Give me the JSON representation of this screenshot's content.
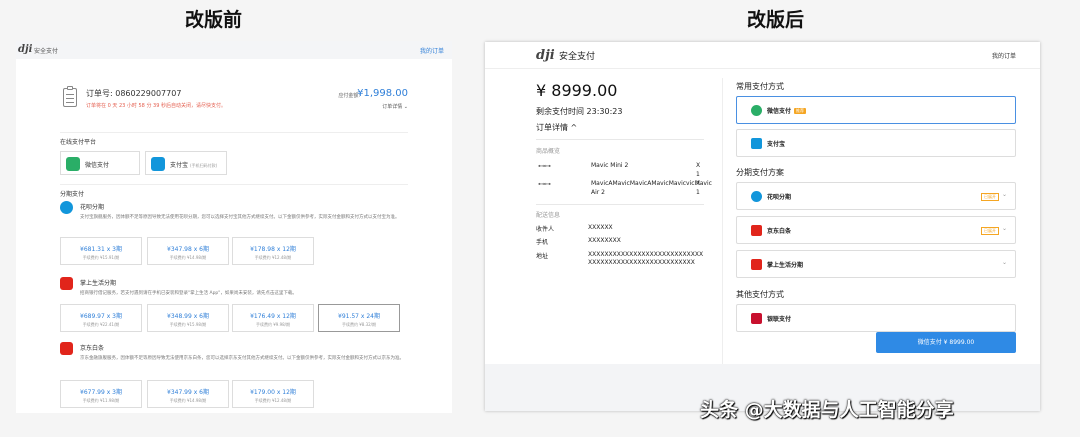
{
  "headings": {
    "before": "改版前",
    "after": "改版后"
  },
  "colors": {
    "accent": "#2f7fd8",
    "wechat_green": "#2aae67",
    "alipay_blue": "#1296db",
    "warn_red": "#e45d4d",
    "badge_orange": "#f5a623",
    "jd_red": "#e1251b"
  },
  "before": {
    "logo": "dji",
    "title": "安全支付",
    "my_orders": "我的订单",
    "order": {
      "number_label": "订单号: 0860229007707",
      "deadline": "订单将在 0 天 23 小时 58 分 39 秒后自动关闭，请尽快支付。",
      "amount_label": "应付金额:",
      "amount": "¥1,998.00",
      "details": "订单详情 ⌄"
    },
    "online_platform": "在线支付平台",
    "wechat": "微信支付",
    "alipay": "支付宝",
    "alipay_note": "(手机扫码付款)",
    "installments_title": "分期支付",
    "huabei": {
      "name": "花呗分期",
      "desc": "支付宝旗舰服务，因体额不足等原因导致无法使用花呗分期，您可以选择支付宝其他方式继续支付。以下金额仅供参考，实际支付金额和支付方式以支付宝为准。",
      "options": [
        {
          "value": "¥681.31 x 3期",
          "fee": "手续费约 ¥15.91/期"
        },
        {
          "value": "¥347.98 x 6期",
          "fee": "手续费约 ¥14.98/期"
        },
        {
          "value": "¥178.98 x 12期",
          "fee": "手续费约 ¥12.48/期"
        }
      ]
    },
    "zsh": {
      "name": "掌上生活分期",
      "desc": "招商银行借记服务，若支付遇到请在手机已安装和登录\"掌上生活 App\"，如果尚未安装，请先点击这里下载。",
      "options": [
        {
          "value": "¥689.97 x 3期",
          "fee": "手续费约 ¥22.41/期"
        },
        {
          "value": "¥348.99 x 6期",
          "fee": "手续费约 ¥15.98/期"
        },
        {
          "value": "¥176.49 x 12期",
          "fee": "手续费约 ¥9.98/期"
        },
        {
          "value": "¥91.57 x 24期",
          "fee": "手续费约 ¥8.32/期"
        }
      ]
    },
    "jd": {
      "name": "京东白条",
      "desc": "京东金融旗舰服务，因体额不足等原因导致无法使用京东白条，您可以选择京东支付其他方式继续支付。以下金额仅供参考，实际支付金额和支付方式以京东为准。",
      "options": [
        {
          "value": "¥677.99 x 3期",
          "fee": "手续费约 ¥11.98/期"
        },
        {
          "value": "¥347.99 x 6期",
          "fee": "手续费约 ¥14.98/期"
        },
        {
          "value": "¥179.00 x 12期",
          "fee": "手续费约 ¥12.48/期"
        }
      ]
    }
  },
  "after": {
    "logo": "dji",
    "title": "安全支付",
    "my_orders": "我的订单",
    "amount": "¥ 8999.00",
    "remaining": "剩余支付时间 23:30:23",
    "order_details": "订单详情 ^",
    "products_label": "商品概览",
    "products": [
      {
        "icon": "⊷⊶",
        "name": "Mavic Mini 2",
        "qty": "X\n1"
      },
      {
        "icon": "⊷⊶",
        "name": "MavicAMavicMavicAMavicMavicvicMavic Air 2",
        "qty": "X\n1"
      }
    ],
    "delivery_label": "配送信息",
    "recipient_k": "收件人",
    "recipient_v": "XXXXXX",
    "phone_k": "手机",
    "phone_v": "XXXXXXXX",
    "addr_k": "地址",
    "addr_v": "XXXXXXXXXXXXXXXXXXXXXXXXXXXXXXXXXXXXXXXXXXXXXXXXXXXXXX",
    "common_methods": "常用支付方式",
    "wechat": "微信支付",
    "wechat_tag": "推荐",
    "alipay": "支付宝",
    "installment_title": "分期支付方案",
    "huabei": "花呗分期",
    "huabei_badge": "已展开",
    "jd": "京东白条",
    "jd_badge": "已展开",
    "zsh": "掌上生活分期",
    "other_methods": "其他支付方式",
    "unionpay": "银联支付",
    "pay_button": "微信支付 ¥ 8999.00"
  },
  "watermark": "头条 @大数据与人工智能分享"
}
